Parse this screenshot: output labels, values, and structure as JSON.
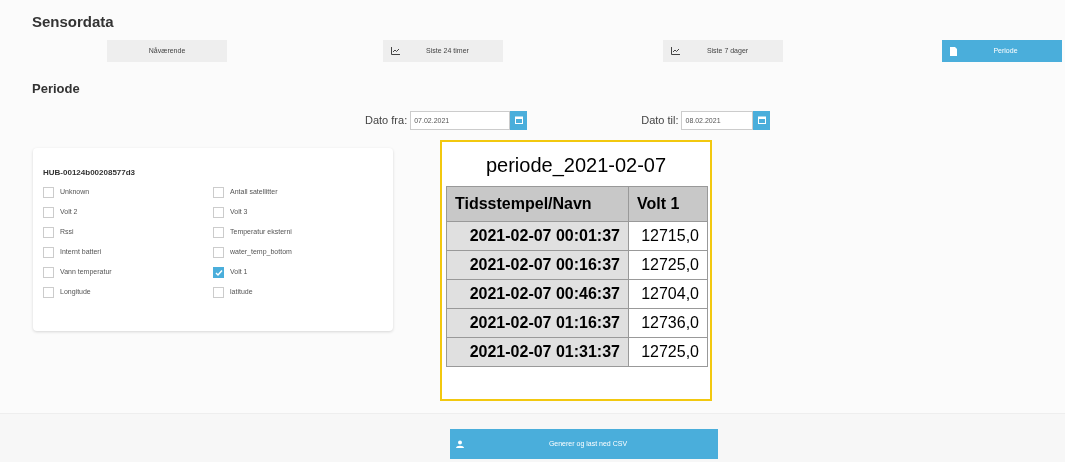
{
  "heading": "Sensordata",
  "range_buttons": [
    {
      "label": "Nåværende",
      "kind": "plain",
      "selected": false
    },
    {
      "label": "Siste 24 timer",
      "kind": "chart",
      "selected": false
    },
    {
      "label": "Siste 7 dager",
      "kind": "chart",
      "selected": false
    },
    {
      "label": "Periode",
      "kind": "file",
      "selected": true
    }
  ],
  "period": {
    "heading": "Periode",
    "from": {
      "label": "Dato fra:",
      "value": "07.02.2021"
    },
    "to": {
      "label": "Dato til:",
      "value": "08.02.2021"
    }
  },
  "sensor_card": {
    "title": "HUB-00124b00208577d3",
    "options": [
      {
        "label": "Unknown",
        "checked": false
      },
      {
        "label": "Antall satellitter",
        "checked": false
      },
      {
        "label": "Volt 2",
        "checked": false
      },
      {
        "label": "Volt 3",
        "checked": false
      },
      {
        "label": "Rssi",
        "checked": false
      },
      {
        "label": "Temperatur eksterni",
        "checked": false
      },
      {
        "label": "Internt batteri",
        "checked": false
      },
      {
        "label": "water_temp_bottom",
        "checked": false
      },
      {
        "label": "Vann temperatur",
        "checked": false
      },
      {
        "label": "Volt 1",
        "checked": true
      },
      {
        "label": "Longitude",
        "checked": false
      },
      {
        "label": "latitude",
        "checked": false
      }
    ]
  },
  "csv_preview": {
    "title": "periode_2021-02-07",
    "columns": [
      "Tidsstempel/Navn",
      "Volt 1"
    ],
    "rows": [
      [
        "2021-02-07 00:01:37",
        "12715,0"
      ],
      [
        "2021-02-07 00:16:37",
        "12725,0"
      ],
      [
        "2021-02-07 00:46:37",
        "12704,0"
      ],
      [
        "2021-02-07 01:16:37",
        "12736,0"
      ],
      [
        "2021-02-07 01:31:37",
        "12725,0"
      ]
    ]
  },
  "download_button": {
    "label": "Generer og last ned CSV"
  }
}
